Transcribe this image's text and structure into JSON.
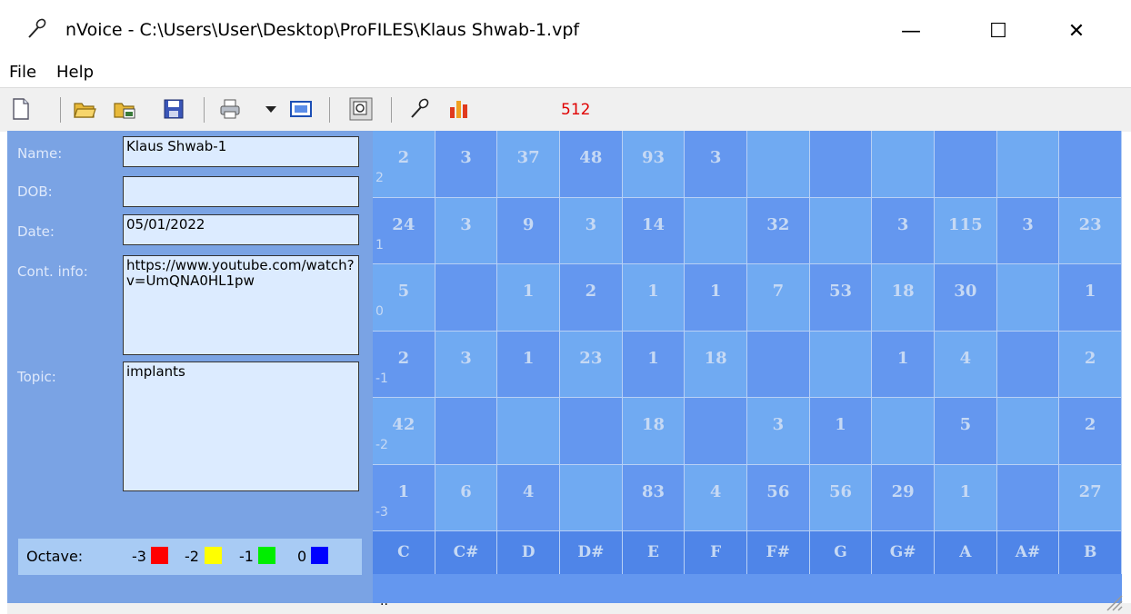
{
  "window": {
    "title": "nVoice - C:\\Users\\User\\Desktop\\ProFILES\\Klaus Shwab-1.vpf",
    "minimize_glyph": "—",
    "maximize_glyph": "☐",
    "close_glyph": "✕"
  },
  "menu": {
    "file": "File",
    "help": "Help"
  },
  "toolbar": {
    "icons": [
      "new-file-icon",
      "open-folder-icon",
      "open-image-icon",
      "save-icon",
      "print-icon",
      "print-dropdown-icon",
      "view-icon",
      "report-icon",
      "microphone-icon",
      "bar-chart-icon"
    ],
    "count": "512"
  },
  "form": {
    "name_label": "Name:",
    "name_value": "Klaus Shwab-1",
    "dob_label": "DOB:",
    "dob_value": "",
    "date_label": "Date:",
    "date_value": "05/01/2022",
    "contact_label": "Cont. info:",
    "contact_value": "https://www.youtube.com/watch?v=UmQNA0HL1pw",
    "topic_label": "Topic:",
    "topic_value": "implants"
  },
  "legend": {
    "label": "Octave:",
    "items": [
      {
        "label": "-3",
        "color": "#ff0000"
      },
      {
        "label": "-2",
        "color": "#ffff00"
      },
      {
        "label": "-1",
        "color": "#00ee00"
      },
      {
        "label": "0",
        "color": "#0000ff"
      }
    ]
  },
  "grid": {
    "notes": [
      "C",
      "C#",
      "D",
      "D#",
      "E",
      "F",
      "F#",
      "G",
      "G#",
      "A",
      "A#",
      "B"
    ],
    "rows": [
      {
        "octave": "2",
        "values": [
          "2",
          "3",
          "37",
          "48",
          "93",
          "3",
          "",
          "",
          "",
          "",
          "",
          ""
        ]
      },
      {
        "octave": "1",
        "values": [
          "24",
          "3",
          "9",
          "3",
          "14",
          "",
          "32",
          "",
          "3",
          "115",
          "3",
          "23"
        ]
      },
      {
        "octave": "0",
        "values": [
          "5",
          "",
          "1",
          "2",
          "1",
          "1",
          "7",
          "53",
          "18",
          "30",
          "",
          "1"
        ]
      },
      {
        "octave": "-1",
        "values": [
          "2",
          "3",
          "1",
          "23",
          "1",
          "18",
          "",
          "",
          "1",
          "4",
          "",
          "2"
        ]
      },
      {
        "octave": "-2",
        "values": [
          "42",
          "",
          "",
          "",
          "18",
          "",
          "3",
          "1",
          "",
          "5",
          "",
          "2"
        ]
      },
      {
        "octave": "-3",
        "values": [
          "1",
          "6",
          "4",
          "",
          "83",
          "4",
          "56",
          "56",
          "29",
          "1",
          "",
          "27"
        ]
      }
    ],
    "colors": {
      "background": "#6497ef",
      "alt": "#70aaf2",
      "notes_row": "#4f85e8"
    }
  },
  "status": {
    "text": ".."
  }
}
